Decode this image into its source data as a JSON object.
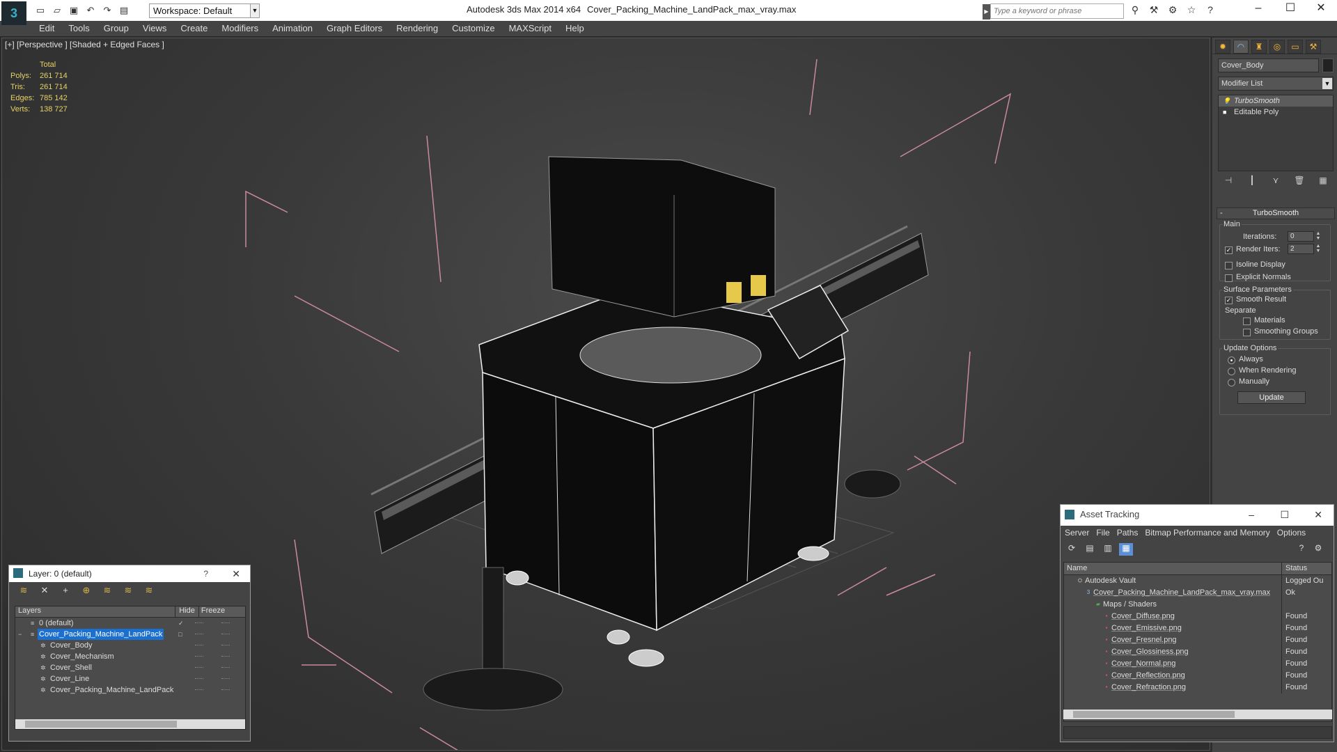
{
  "titlebar": {
    "workspace": "Workspace: Default",
    "app_title": "Autodesk 3ds Max  2014 x64",
    "file_title": "Cover_Packing_Machine_LandPack_max_vray.max",
    "search_placeholder": "Type a keyword or phrase"
  },
  "menu": [
    "Edit",
    "Tools",
    "Group",
    "Views",
    "Create",
    "Modifiers",
    "Animation",
    "Graph Editors",
    "Rendering",
    "Customize",
    "MAXScript",
    "Help"
  ],
  "viewport": {
    "label": "[+] [Perspective ] [Shaded + Edged Faces ]",
    "stats": {
      "header": "Total",
      "rows": [
        {
          "k": "Polys:",
          "v": "261 714"
        },
        {
          "k": "Tris:",
          "v": "261 714"
        },
        {
          "k": "Edges:",
          "v": "785 142"
        },
        {
          "k": "Verts:",
          "v": "138 727"
        }
      ]
    }
  },
  "command_panel": {
    "object_name": "Cover_Body",
    "modifier_list": "Modifier List",
    "stack": [
      "TurboSmooth",
      "Editable Poly"
    ],
    "rollout": "TurboSmooth",
    "main_label": "Main",
    "iterations_label": "Iterations:",
    "iterations_value": "0",
    "render_iters_label": "Render Iters:",
    "render_iters_value": "2",
    "isoline": "Isoline Display",
    "explicit_normals": "Explicit Normals",
    "surface_params": "Surface Parameters",
    "smooth_result": "Smooth Result",
    "separate": "Separate",
    "materials": "Materials",
    "smoothing_groups": "Smoothing Groups",
    "update_options": "Update Options",
    "always": "Always",
    "when_rendering": "When Rendering",
    "manually": "Manually",
    "update_button": "Update"
  },
  "layer_window": {
    "title": "Layer: 0 (default)",
    "help": "?",
    "col_layers": "Layers",
    "col_hide": "Hide",
    "col_freeze": "Freeze",
    "rows": [
      {
        "name": "0 (default)",
        "indent": 0
      },
      {
        "name": "Cover_Packing_Machine_LandPack",
        "indent": 0
      },
      {
        "name": "Cover_Body",
        "indent": 1
      },
      {
        "name": "Cover_Mechanism",
        "indent": 1
      },
      {
        "name": "Cover_Shell",
        "indent": 1
      },
      {
        "name": "Cover_Line",
        "indent": 1
      },
      {
        "name": "Cover_Packing_Machine_LandPack",
        "indent": 1
      }
    ]
  },
  "asset_window": {
    "title": "Asset Tracking",
    "menu": [
      "Server",
      "File",
      "Paths",
      "Bitmap Performance and Memory",
      "Options"
    ],
    "col_name": "Name",
    "col_status": "Status",
    "rows": [
      {
        "name": "Autodesk Vault",
        "status": "Logged Ou",
        "level": 0
      },
      {
        "name": "Cover_Packing_Machine_LandPack_max_vray.max",
        "status": "Ok",
        "level": 1
      },
      {
        "name": "Maps / Shaders",
        "status": "",
        "level": 2
      },
      {
        "name": "Cover_Diffuse.png",
        "status": "Found",
        "level": 3
      },
      {
        "name": "Cover_Emissive.png",
        "status": "Found",
        "level": 3
      },
      {
        "name": "Cover_Fresnel.png",
        "status": "Found",
        "level": 3
      },
      {
        "name": "Cover_Glossiness.png",
        "status": "Found",
        "level": 3
      },
      {
        "name": "Cover_Normal.png",
        "status": "Found",
        "level": 3
      },
      {
        "name": "Cover_Reflection.png",
        "status": "Found",
        "level": 3
      },
      {
        "name": "Cover_Refraction.png",
        "status": "Found",
        "level": 3
      }
    ]
  }
}
